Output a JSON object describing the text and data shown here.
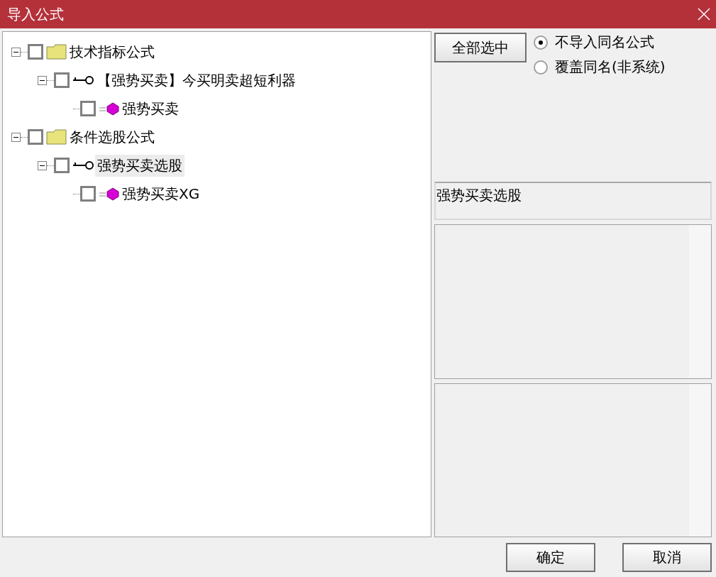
{
  "window": {
    "title": "导入公式"
  },
  "tree": [
    {
      "kind": "folder",
      "label": "技术指标公式",
      "checked": false,
      "expanded": true,
      "selected": false,
      "children": [
        {
          "kind": "formula",
          "label": "【强势买卖】今买明卖超短利器",
          "checked": false,
          "expanded": true,
          "selected": false,
          "children": [
            {
              "kind": "item",
              "label": "强势买卖",
              "checked": false,
              "selected": false
            }
          ]
        }
      ]
    },
    {
      "kind": "folder",
      "label": "条件选股公式",
      "checked": false,
      "expanded": true,
      "selected": false,
      "children": [
        {
          "kind": "formula",
          "label": "强势买卖选股",
          "checked": false,
          "expanded": true,
          "selected": true,
          "children": [
            {
              "kind": "item",
              "label": "强势买卖XG",
              "checked": false,
              "selected": false
            }
          ]
        }
      ]
    }
  ],
  "select_all_button": "全部选中",
  "options": [
    {
      "label": "不导入同名公式",
      "selected": true
    },
    {
      "label": "覆盖同名(非系统)",
      "selected": false
    }
  ],
  "name_field": {
    "value": "强势买卖选股"
  },
  "buttons": [
    "确定",
    "取消"
  ]
}
